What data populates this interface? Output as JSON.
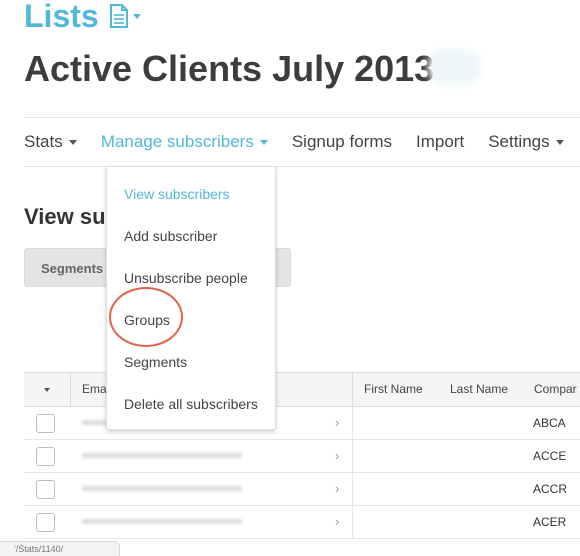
{
  "header": {
    "section_title": "Lists",
    "section_icon": "document-icon",
    "list_name": "Active Clients July 2013"
  },
  "nav": {
    "items": [
      {
        "label": "Stats",
        "has_caret": true,
        "active": false
      },
      {
        "label": "Manage subscribers",
        "has_caret": true,
        "active": true
      },
      {
        "label": "Signup forms",
        "has_caret": false,
        "active": false
      },
      {
        "label": "Import",
        "has_caret": false,
        "active": false
      },
      {
        "label": "Settings",
        "has_caret": true,
        "active": false
      }
    ]
  },
  "main": {
    "heading": "View su",
    "segments_button": "Segments"
  },
  "dropdown": {
    "items": [
      {
        "label": "View subscribers",
        "active": true
      },
      {
        "label": "Add subscriber",
        "active": false
      },
      {
        "label": "Unsubscribe people",
        "active": false
      },
      {
        "label": "Groups",
        "active": false,
        "highlighted": true
      },
      {
        "label": "Segments",
        "active": false
      },
      {
        "label": "Delete all subscribers",
        "active": false
      }
    ]
  },
  "table": {
    "columns": [
      "Ema",
      "First Name",
      "Last Name",
      "Compar"
    ],
    "rows": [
      {
        "company": "ABCA"
      },
      {
        "company": "ACCE"
      },
      {
        "company": "ACCR"
      },
      {
        "company": "ACER"
      }
    ]
  },
  "status": {
    "text": "'/Stats/1140/"
  },
  "colors": {
    "accent": "#52b8d9",
    "highlight_ring": "#e2624a"
  }
}
